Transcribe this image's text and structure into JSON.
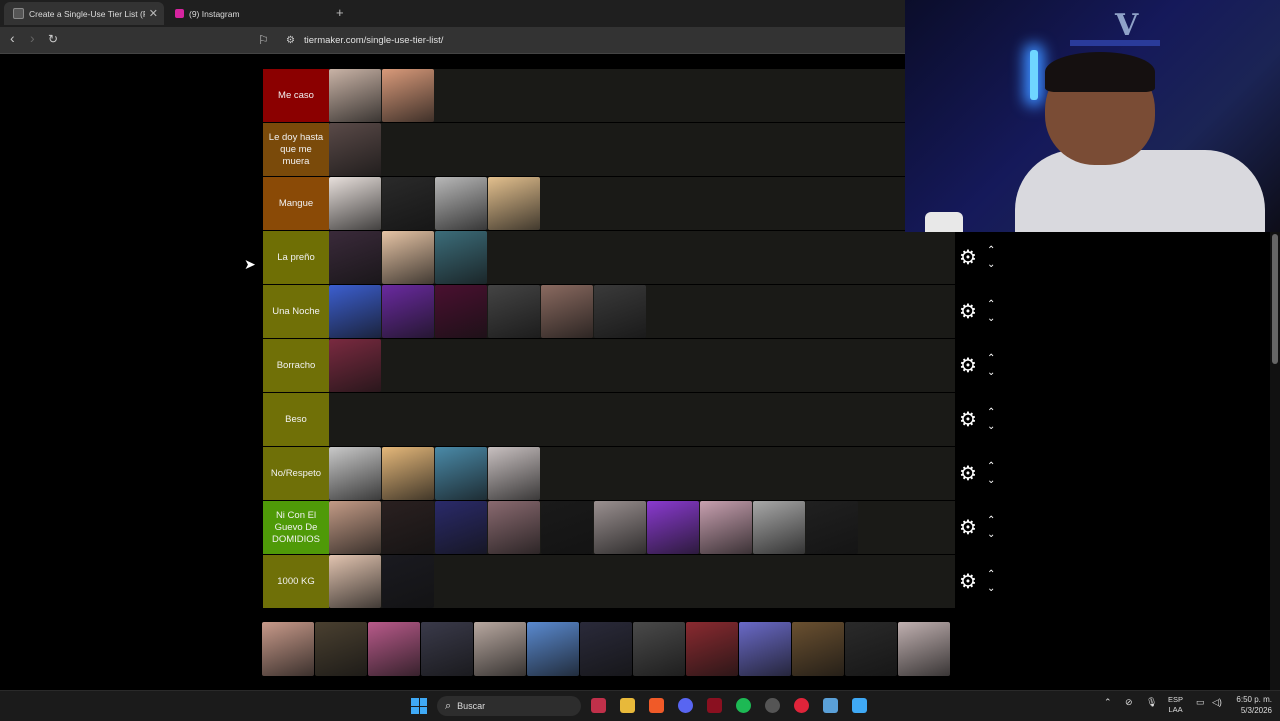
{
  "browser": {
    "tabs": [
      {
        "title": "Create a Single-Use Tier List (Pri",
        "active": true,
        "favicon_color": "#2d2d2d"
      },
      {
        "title": "(9) Instagram",
        "active": false,
        "favicon_color": "#d6249f"
      }
    ],
    "new_tab_label": "+",
    "url": "tiermaker.com/single-use-tier-list/"
  },
  "tiers": [
    {
      "label": "Me caso",
      "color": "#8b0000",
      "items": [
        "#c9b3a6",
        "#d99a7a"
      ]
    },
    {
      "label": "Le doy hasta que me muera",
      "color": "#7a4a0a",
      "items": [
        "#5a4a48"
      ]
    },
    {
      "label": "Mangue",
      "color": "#8a4a06",
      "items": [
        "#e8e0dc",
        "#2a2a2a",
        "#b8b8b8",
        "#e3c08e"
      ]
    },
    {
      "label": "La preño",
      "color": "#6f6f05",
      "items": [
        "#3a2a3a",
        "#e6c4a5",
        "#3c6d7a"
      ]
    },
    {
      "label": "Una Noche",
      "color": "#707007",
      "items": [
        "#3c5fd0",
        "#6a2aa0",
        "#4a1030",
        "#444444",
        "#8a6a60",
        "#3a3a3a"
      ]
    },
    {
      "label": "Borracho",
      "color": "#707007",
      "items": [
        "#7a2a40"
      ]
    },
    {
      "label": "Beso",
      "color": "#707007",
      "items": []
    },
    {
      "label": "No/Respeto",
      "color": "#6f7008",
      "items": [
        "#c9c9c9",
        "#e5b87a",
        "#4a8aa8",
        "#c8c0c0"
      ]
    },
    {
      "label": "Ni Con El Guevo De DOMIDIOS",
      "color": "#4f9a08",
      "items": [
        "#c39b86",
        "#2a2020",
        "#2a2a6a",
        "#8a6a70",
        "#1a1a1a",
        "#9a9090",
        "#8a3ad0",
        "#c8a0b0",
        "#a8a8a8",
        "#202020"
      ]
    },
    {
      "label": "1000 KG",
      "color": "#6f7008",
      "items": [
        "#e2c4b0",
        "#1a1a20"
      ]
    }
  ],
  "pool": [
    "#c89a8a",
    "#4a4030",
    "#b85a8a",
    "#3a3a4a",
    "#b8a8a0",
    "#5a8ad0",
    "#2a2a3a",
    "#4a4a4a",
    "#8a2a30",
    "#6a6ac8",
    "#6a5030",
    "#2a2a2a",
    "#c0b0b0"
  ],
  "taskbar": {
    "search_placeholder": "Buscar",
    "language": "ESP",
    "layout": "LAA",
    "time": "6:50 p. m.",
    "date": "5/3/2026"
  },
  "icons": {
    "gear": "gear-icon",
    "up": "chevron-up-icon",
    "down": "chevron-down-icon"
  }
}
